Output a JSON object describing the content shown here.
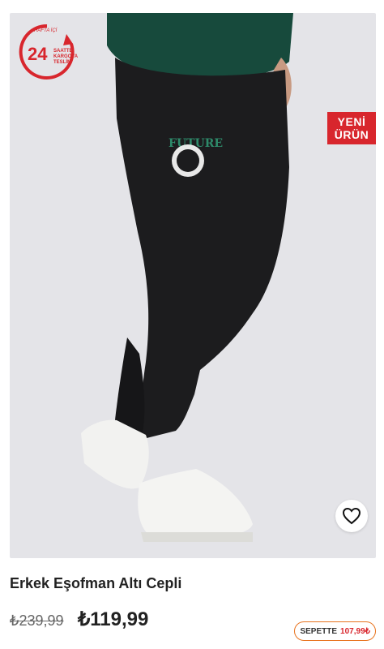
{
  "product": {
    "title": "Erkek Eşofman Altı Cepli",
    "old_price": "₺239,99",
    "price": "₺119,99",
    "basket_label": "SEPETTE",
    "basket_price": "107,99₺"
  },
  "badges": {
    "delivery_top": "HAFTA İÇİ",
    "delivery_number": "24",
    "delivery_line1": "SAATTE",
    "delivery_line2": "KARGOYA",
    "delivery_line3": "TESLİM",
    "new_line1": "YENİ",
    "new_line2": "ÜRÜN"
  },
  "colors": {
    "accent_red": "#d8262d",
    "basket_border": "#e8731e",
    "logo_green": "#2e8a6a"
  },
  "icons": {
    "favorite": "heart-outline-icon"
  }
}
